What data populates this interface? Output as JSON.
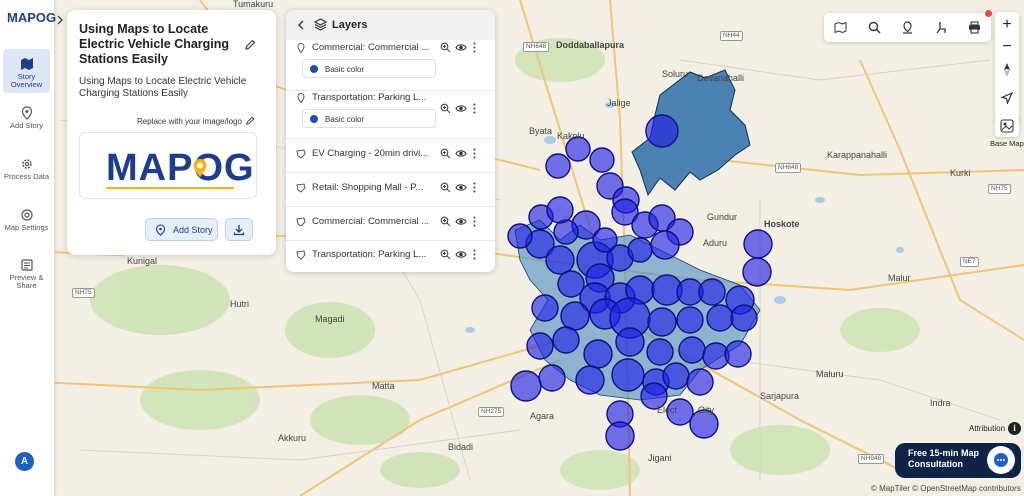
{
  "app": {
    "logo_text": "MAPOG",
    "avatar_initial": "A"
  },
  "sidebar": {
    "items": [
      {
        "label": "Story Overview",
        "icon": "map-icon",
        "active": true
      },
      {
        "label": "Add Story",
        "icon": "location-pin-icon",
        "active": false
      },
      {
        "label": "Process Data",
        "icon": "gear-icon",
        "active": false
      },
      {
        "label": "Map Settings",
        "icon": "settings-icon",
        "active": false
      },
      {
        "label": "Preview & Share",
        "icon": "preview-icon",
        "active": false
      }
    ]
  },
  "story": {
    "title": "Using Maps to Locate Electric Vehicle Charging Stations Easily",
    "description": "Using Maps to Locate Electric Vehicle Charging Stations Easily",
    "replace_image_label": "Replace with your image/logo",
    "logo_text": "MAPOG",
    "add_story_label": "Add Story"
  },
  "layers": {
    "title": "Layers",
    "items": [
      {
        "name": "Commercial: Commercial ...",
        "type": "point",
        "style": "Basic color"
      },
      {
        "name": "Transportation: Parking L...",
        "type": "point",
        "style": "Basic color"
      },
      {
        "name": "EV Charging - 20min drivi...",
        "type": "polygon"
      },
      {
        "name": "Retail: Shopping Mall - P...",
        "type": "polygon"
      },
      {
        "name": "Commercial: Commercial ...",
        "type": "polygon"
      },
      {
        "name": "Transportation: Parking L...",
        "type": "polygon"
      }
    ]
  },
  "map_controls": {
    "basemap_label": "Base Map",
    "attribution_label": "Attribution",
    "consultation_label": "Free 15-min Map Consultation",
    "credit": "© MapTiler © OpenStreetMap contributors"
  },
  "map_labels": [
    "Tumakuru",
    "Doddaballapura",
    "Soluru",
    "Devanahalli",
    "Jalige",
    "Byata",
    "Kakolu",
    "Karappanahalli",
    "Kurki",
    "Gundur",
    "Hoskote",
    "Aduru",
    "Kunigal",
    "Malur",
    "Hutri",
    "Magadi",
    "Matta",
    "Sarjapura",
    "Agara",
    "Bidadi",
    "Akkuru",
    "Jigani",
    "Elect",
    "Oity",
    "Maluru",
    "Indra"
  ],
  "road_labels": [
    "NH648",
    "NH44",
    "NH648",
    "NH75",
    "NE7",
    "NH75",
    "NH275",
    "NH948"
  ],
  "colors": {
    "accent": "#1f3d8a",
    "circle_fill": "#1e1ee6",
    "circle_stroke": "#101080",
    "isochrone": "#2d6fa8"
  }
}
